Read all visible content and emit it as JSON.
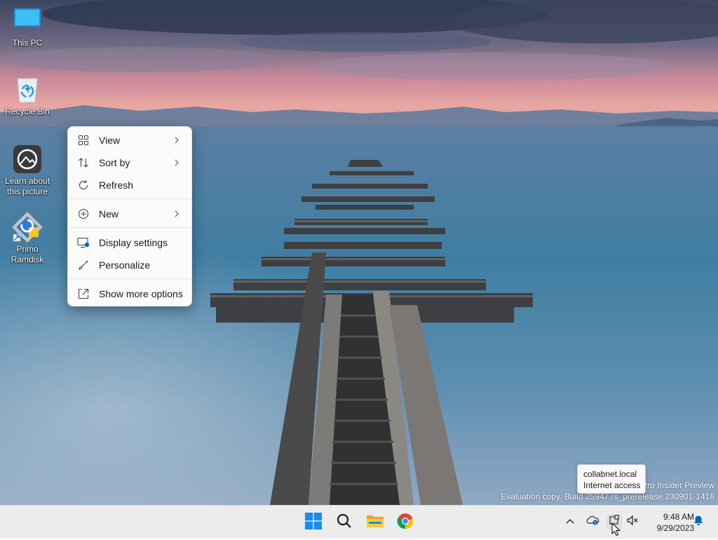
{
  "desktop": {
    "icons": [
      {
        "label": "This PC",
        "icon": "monitor-icon"
      },
      {
        "label": "Recycle Bin",
        "icon": "recycle-bin-icon"
      },
      {
        "label_line1": "Learn about",
        "label_line2": "this picture",
        "icon": "camera-icon"
      },
      {
        "label_line1": "Primo",
        "label_line2": "Ramdisk",
        "icon": "ramdisk-icon"
      }
    ]
  },
  "context_menu": {
    "items": [
      {
        "label": "View",
        "icon": "grid-icon",
        "submenu": true
      },
      {
        "label": "Sort by",
        "icon": "sort-icon",
        "submenu": true
      },
      {
        "label": "Refresh",
        "icon": "refresh-icon",
        "submenu": false
      },
      {
        "label": "New",
        "icon": "plus-circle-icon",
        "submenu": true
      },
      {
        "label": "Display settings",
        "icon": "display-settings-icon",
        "submenu": false
      },
      {
        "label": "Personalize",
        "icon": "brush-icon",
        "submenu": false
      },
      {
        "label": "Show more options",
        "icon": "expand-icon",
        "submenu": false
      }
    ]
  },
  "watermark": {
    "line1": "Pro Insider Preview",
    "line2": "Evaluation copy. Build 25947.rs_prerelease.230901-1416"
  },
  "tooltip": {
    "line1": "collabnet.local",
    "line2": "Internet access"
  },
  "taskbar": {
    "apps": [
      "start-icon",
      "search-icon",
      "file-explorer-icon",
      "chrome-icon"
    ],
    "tray": [
      "chevron-up-icon",
      "onedrive-icon",
      "network-icon",
      "volume-muted-icon"
    ],
    "time": "9:48 AM",
    "date": "9/29/2023",
    "notification_icon": "bell-icon"
  },
  "colors": {
    "accent": "#0067c0",
    "taskbar_bg": "#ececec",
    "menu_bg": "#fbfbfb"
  }
}
